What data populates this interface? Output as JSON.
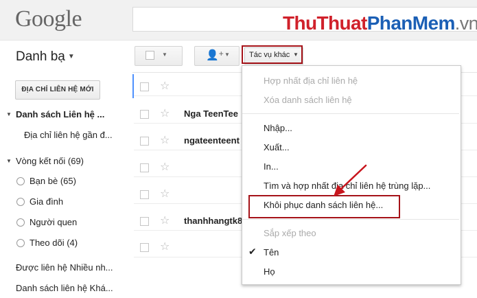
{
  "header": {
    "logo": "Google",
    "watermark": {
      "part1": "Thu",
      "part2": "Thuat",
      "part3": "PhanMem",
      "part4": ".vn"
    }
  },
  "toolbar": {
    "contacts_title": "Danh bạ",
    "action_menu_label": "Tác vụ khác"
  },
  "sidebar": {
    "new_contact_button": "ĐỊA CHỈ LIÊN HỆ MỚI",
    "items": [
      {
        "label": "Danh sách Liên hệ ..."
      },
      {
        "label": "Địa chỉ liên hệ gần đ..."
      },
      {
        "label": "Vòng kết nối (69)"
      },
      {
        "label": "Bạn bè (65)"
      },
      {
        "label": "Gia đình"
      },
      {
        "label": "Người quen"
      },
      {
        "label": "Theo dõi (4)"
      },
      {
        "label": "Được liên hệ Nhiều nh..."
      },
      {
        "label": "Danh sách liên hệ Khá..."
      }
    ]
  },
  "contacts": [
    {
      "name": ""
    },
    {
      "name": "Nga TeenTee"
    },
    {
      "name": "ngateenteent"
    },
    {
      "name": ""
    },
    {
      "name": ""
    },
    {
      "name": "thanhhangtk8"
    },
    {
      "name": ""
    }
  ],
  "menu": {
    "items": [
      {
        "label": "Hợp nhất địa chỉ liên hệ",
        "disabled": true
      },
      {
        "label": "Xóa danh sách liên hệ",
        "disabled": true
      },
      {
        "label": "Nhập...",
        "disabled": false
      },
      {
        "label": "Xuất...",
        "disabled": false
      },
      {
        "label": "In...",
        "disabled": false
      },
      {
        "label": "Tìm và hợp nhất địa chỉ liên hệ trùng lặp...",
        "disabled": false
      },
      {
        "label": "Khôi phục danh sách liên hệ...",
        "disabled": false
      }
    ],
    "sort_header": "Sắp xếp theo",
    "sort_options": [
      {
        "label": "Tên",
        "checked": true
      },
      {
        "label": "Họ",
        "checked": false
      }
    ]
  },
  "colors": {
    "highlight": "#a51218",
    "accent": "#4d90fe"
  }
}
